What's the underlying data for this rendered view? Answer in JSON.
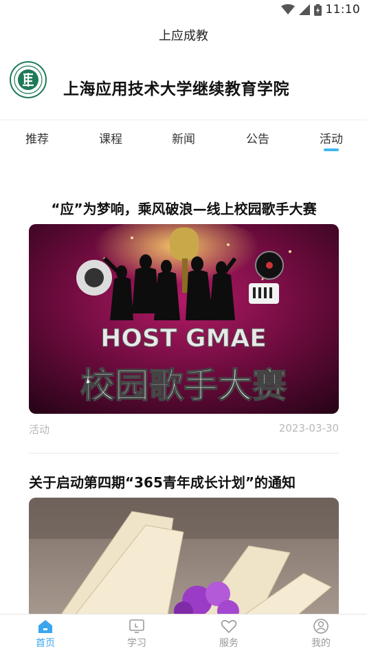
{
  "status": {
    "time": "11:10"
  },
  "app_title": "上应成教",
  "brand": {
    "name": "上海应用技术大学继续教育学院"
  },
  "tabs": [
    {
      "label": "推荐"
    },
    {
      "label": "课程"
    },
    {
      "label": "新闻"
    },
    {
      "label": "公告"
    },
    {
      "label": "活动"
    }
  ],
  "active_tab": "活动",
  "articles": [
    {
      "title": "“应”为梦响，乘风破浪—线上校园歌手大赛",
      "banner_text_top": "HOST GMAE",
      "banner_text_main": "校园歌手大赛",
      "tag": "活动",
      "date": "2023-03-30"
    },
    {
      "title": "关于启动第四期“365青年成长计划”的通知"
    }
  ],
  "bottom_nav": [
    {
      "label": "首页",
      "icon": "home-icon",
      "active": true
    },
    {
      "label": "学习",
      "icon": "study-icon",
      "active": false
    },
    {
      "label": "服务",
      "icon": "heart-icon",
      "active": false
    },
    {
      "label": "我的",
      "icon": "profile-icon",
      "active": false
    }
  ],
  "colors": {
    "accent": "#3fb8f0",
    "nav_active": "#3aa6ee",
    "muted": "#b8b8b8"
  }
}
